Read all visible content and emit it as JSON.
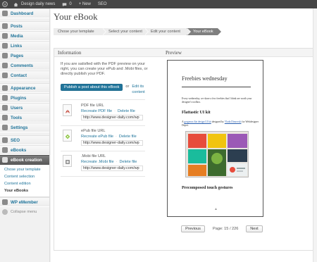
{
  "admin_bar": {
    "site_name": "Design daily news",
    "comments_count": "0",
    "new_label": "+ New",
    "seo_label": "SEO"
  },
  "sidebar": {
    "items": [
      {
        "label": "Dashboard",
        "icon": "dashboard-icon"
      },
      {
        "label": "Posts",
        "icon": "posts-icon"
      },
      {
        "label": "Media",
        "icon": "media-icon"
      },
      {
        "label": "Links",
        "icon": "links-icon"
      },
      {
        "label": "Pages",
        "icon": "pages-icon"
      },
      {
        "label": "Comments",
        "icon": "comments-icon"
      },
      {
        "label": "Contact",
        "icon": "contact-icon"
      },
      {
        "label": "Appearance",
        "icon": "appearance-icon"
      },
      {
        "label": "Plugins",
        "icon": "plugins-icon"
      },
      {
        "label": "Users",
        "icon": "users-icon"
      },
      {
        "label": "Tools",
        "icon": "tools-icon"
      },
      {
        "label": "Settings",
        "icon": "settings-icon"
      },
      {
        "label": "SEO",
        "icon": "seo-icon"
      },
      {
        "label": "eBooks",
        "icon": "ebooks-icon"
      },
      {
        "label": "eBook creation",
        "icon": "ebook-creation-icon"
      },
      {
        "label": "WP eMember",
        "icon": "wp-emember-icon"
      }
    ],
    "submenu": [
      "Chose your template",
      "Content selection",
      "Content edition",
      "Your eBooks"
    ],
    "collapse_label": "Collapse menu"
  },
  "main": {
    "page_title": "Your eBook",
    "steps": [
      "Chose your template",
      "Select your content",
      "Edit your content",
      "Your eBook"
    ]
  },
  "information": {
    "heading": "Information",
    "text": "If you are satisfied with the PDF preview on your right, you can create your ePub and .Mobi files, or directly publish your PDF.",
    "publish_button": "Publish a post about this eBook",
    "or": "or",
    "edit_content": "Edit its content"
  },
  "files": [
    {
      "label": "PDF file URL",
      "recreate": "Recreate PDF file",
      "delete": "Delete file",
      "url": "http://www.designer-daily.com/wp",
      "icon": "pdf-file-icon"
    },
    {
      "label": "ePub file URL",
      "recreate": "Recreate ePub file",
      "delete": "Delete file",
      "url": "http://www.designer-daily.com/wp",
      "icon": "epub-file-icon"
    },
    {
      "label": ".Mobi file URL",
      "recreate": "Recreate .Mobi file",
      "delete": "Delete file",
      "url": "http://www.designer-daily.com/wp",
      "icon": "mobi-file-icon"
    }
  ],
  "preview": {
    "heading": "Preview",
    "doc_title": "Freebies wednesday",
    "intro": "Every wednesday, we share a few freebies that I think are worth your designer's toolbox.",
    "section1": "Flattastic UI kit",
    "section1_text_a": "A",
    "section1_link1": "gorgeous flat design UI kit",
    "section1_text_b": "designed by",
    "section1_link2": "Vlada Dimovski",
    "section1_text_c": "for Webdesigner Depot.",
    "section2": "Precomposed touch gestures",
    "previous": "Previous",
    "page_info": "Page: 15 / 226",
    "next": "Next"
  },
  "colors": {
    "link": "#21759b",
    "admin_bar": "#464646",
    "active_menu": "#6b6b6b"
  }
}
